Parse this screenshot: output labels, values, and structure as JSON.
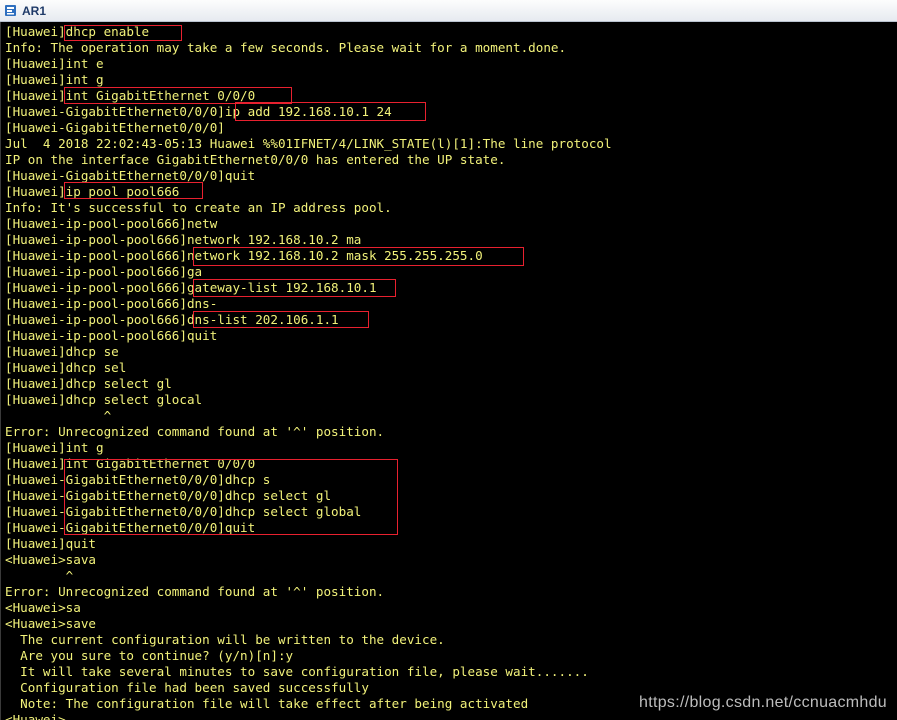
{
  "window": {
    "title": "AR1",
    "icon": "router-terminal-icon"
  },
  "terminal": {
    "text_color": "#f2f27a",
    "background": "#000000",
    "highlight_color": "#e8212f",
    "lines": [
      "[Huawei]dhcp enable",
      "Info: The operation may take a few seconds. Please wait for a moment.done.",
      "[Huawei]int e",
      "[Huawei]int g",
      "[Huawei]int GigabitEthernet 0/0/0",
      "[Huawei-GigabitEthernet0/0/0]ip add 192.168.10.1 24",
      "[Huawei-GigabitEthernet0/0/0]",
      "Jul  4 2018 22:02:43-05:13 Huawei %%01IFNET/4/LINK_STATE(l)[1]:The line protocol",
      "IP on the interface GigabitEthernet0/0/0 has entered the UP state.",
      "[Huawei-GigabitEthernet0/0/0]quit",
      "[Huawei]ip pool pool666",
      "Info: It's successful to create an IP address pool.",
      "[Huawei-ip-pool-pool666]netw",
      "[Huawei-ip-pool-pool666]network 192.168.10.2 ma",
      "[Huawei-ip-pool-pool666]network 192.168.10.2 mask 255.255.255.0",
      "[Huawei-ip-pool-pool666]ga",
      "[Huawei-ip-pool-pool666]gateway-list 192.168.10.1",
      "[Huawei-ip-pool-pool666]dns-",
      "[Huawei-ip-pool-pool666]dns-list 202.106.1.1",
      "[Huawei-ip-pool-pool666]quit",
      "[Huawei]dhcp se",
      "[Huawei]dhcp sel",
      "[Huawei]dhcp select gl",
      "[Huawei]dhcp select glocal",
      "             ^",
      "Error: Unrecognized command found at '^' position.",
      "[Huawei]int g",
      "[Huawei]int GigabitEthernet 0/0/0",
      "[Huawei-GigabitEthernet0/0/0]dhcp s",
      "[Huawei-GigabitEthernet0/0/0]dhcp select gl",
      "[Huawei-GigabitEthernet0/0/0]dhcp select global",
      "[Huawei-GigabitEthernet0/0/0]quit",
      "[Huawei]quit",
      "<Huawei>sava",
      "        ^",
      "Error: Unrecognized command found at '^' position.",
      "<Huawei>sa",
      "<Huawei>save",
      "  The current configuration will be written to the device.",
      "  Are you sure to continue? (y/n)[n]:y",
      "  It will take several minutes to save configuration file, please wait.......",
      "  Configuration file had been saved successfully",
      "  Note: The configuration file will take effect after being activated",
      "<Huawei>"
    ]
  },
  "watermark": "https://blog.csdn.net/ccnuacmhdu"
}
